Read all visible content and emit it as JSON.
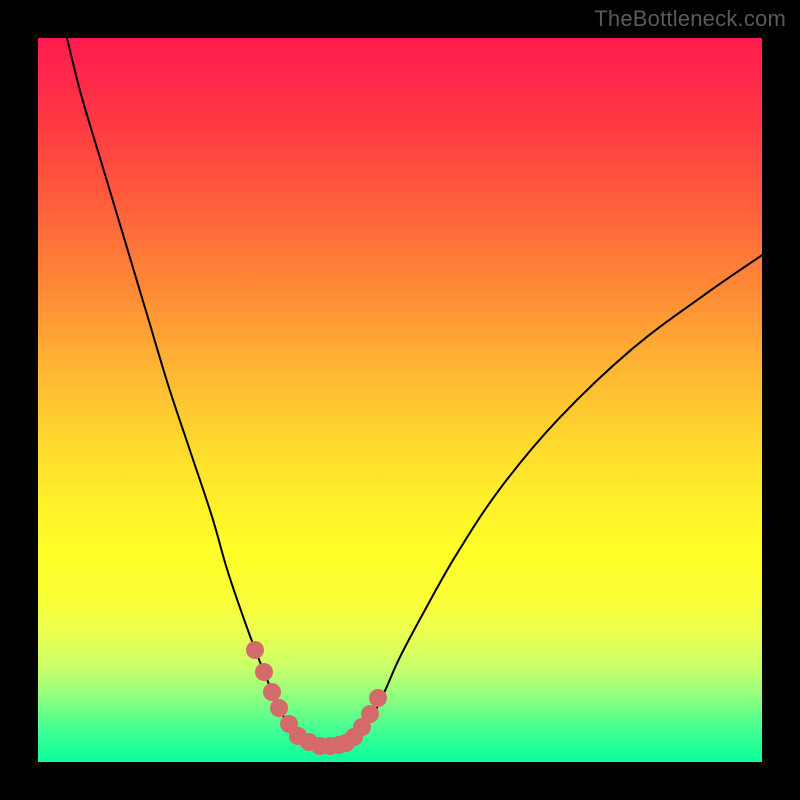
{
  "watermark": "TheBottleneck.com",
  "chart_data": {
    "type": "line",
    "title": "",
    "xlabel": "",
    "ylabel": "",
    "xlim": [
      0,
      100
    ],
    "ylim": [
      0,
      100
    ],
    "grid": false,
    "series": [
      {
        "name": "bottleneck-curve",
        "color": "#000000",
        "stroke_width": 2,
        "x": [
          4,
          6,
          9,
          12,
          15,
          18,
          21,
          24,
          26,
          28,
          30,
          32,
          33.5,
          35.5,
          37.5,
          39.5,
          41,
          42,
          44,
          46,
          48,
          50,
          54,
          58,
          64,
          72,
          82,
          92,
          100
        ],
        "y": [
          100,
          92,
          82,
          72,
          62,
          52,
          43,
          34,
          27,
          21,
          15.5,
          10.5,
          7,
          4.2,
          2.6,
          2.2,
          2.2,
          2.4,
          3.6,
          6,
          10,
          14.5,
          22,
          29,
          38,
          47.5,
          57,
          64.5,
          70
        ]
      }
    ],
    "markers": {
      "name": "highlight-dots",
      "color": "#d46a6a",
      "radius_px": 9,
      "x": [
        30.0,
        31.2,
        32.3,
        33.3,
        34.6,
        35.9,
        37.4,
        38.9,
        40.4,
        41.6,
        42.5,
        43.6,
        44.8,
        45.9,
        47.0
      ],
      "y": [
        15.5,
        12.4,
        9.7,
        7.4,
        5.2,
        3.6,
        2.7,
        2.2,
        2.2,
        2.3,
        2.6,
        3.4,
        4.8,
        6.6,
        8.8
      ]
    },
    "background_gradient": {
      "direction": "vertical",
      "stops": [
        {
          "pos": 0.0,
          "color": "#ff1a4d"
        },
        {
          "pos": 0.26,
          "color": "#ff6a3a"
        },
        {
          "pos": 0.56,
          "color": "#ffd92e"
        },
        {
          "pos": 0.78,
          "color": "#f9ff3a"
        },
        {
          "pos": 1.0,
          "color": "#0aff9c"
        }
      ]
    }
  }
}
